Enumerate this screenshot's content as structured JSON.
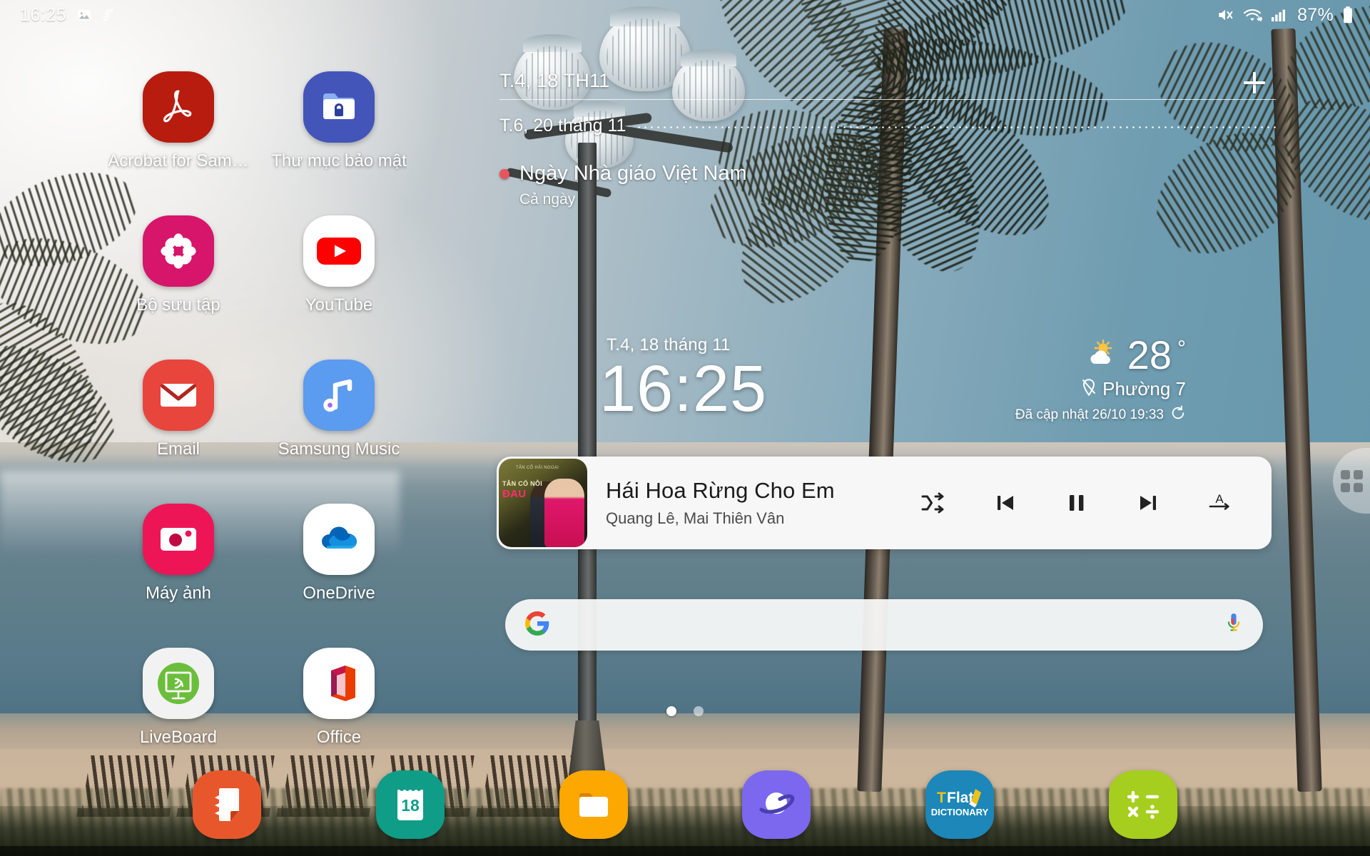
{
  "status_bar": {
    "clock": "16:25",
    "left_icons": [
      "image-icon",
      "music-note-icon"
    ],
    "right_icons": [
      "mute-icon",
      "wifi-icon",
      "signal-icon",
      "battery-icon"
    ],
    "battery_percent": "87%"
  },
  "calendar_widget": {
    "today_label": "T.4, 18 TH11",
    "add_label": "+",
    "next_date": "T.6, 20 tháng 11",
    "event_title": "Ngày Nhà giáo Việt Nam",
    "event_time": "Cả ngày",
    "event_dot_color": "#E8545E"
  },
  "clock_widget": {
    "date": "T.4, 18 tháng 11",
    "time": "16:25"
  },
  "weather_widget": {
    "temperature": "28",
    "degree": "°",
    "condition_icon": "partly-cloudy-icon",
    "location": "Phường 7",
    "updated": "Đã cập nhật 26/10 19:33",
    "refresh_icon": "refresh-icon"
  },
  "apps": [
    {
      "label": "Acrobat for Sam…",
      "icon": "acrobat-icon",
      "color": "#B71C0F"
    },
    {
      "label": "Thư mục bảo mật",
      "icon": "secure-folder-icon",
      "color": "#4355B9"
    },
    {
      "label": "Bộ sưu tập",
      "icon": "gallery-icon",
      "color": "#D6156B"
    },
    {
      "label": "YouTube",
      "icon": "youtube-icon",
      "color": "#FFFFFF"
    },
    {
      "label": "Email",
      "icon": "email-icon",
      "color": "#E8453C"
    },
    {
      "label": "Samsung Music",
      "icon": "samsung-music-icon",
      "color": "#5B9BF0"
    },
    {
      "label": "Máy ảnh",
      "icon": "camera-icon",
      "color": "#EE1556"
    },
    {
      "label": "OneDrive",
      "icon": "onedrive-icon",
      "color": "#FFFFFF"
    },
    {
      "label": "LiveBoard",
      "icon": "liveboard-icon",
      "color": "#F2F2F2"
    },
    {
      "label": "Office",
      "icon": "office-icon",
      "color": "#FFFFFF"
    }
  ],
  "music_widget": {
    "album_art_line0": "TÂN CỔ HẢI NGOẠI",
    "album_art_line1": "TÂN CỔ NỖI",
    "album_art_line2": "ĐAU",
    "title": "Hái Hoa Rừng Cho Em",
    "artist": "Quang Lê, Mai Thiên Vân",
    "controls": [
      {
        "name": "shuffle-icon",
        "label": "Shuffle"
      },
      {
        "name": "previous-icon",
        "label": "Previous"
      },
      {
        "name": "pause-icon",
        "label": "Pause"
      },
      {
        "name": "next-icon",
        "label": "Next"
      },
      {
        "name": "repeat-a-icon",
        "label": "Repeat A"
      }
    ]
  },
  "search_bar": {
    "logo": "google-logo",
    "value": "",
    "placeholder": "",
    "mic_icon": "microphone-icon"
  },
  "page_dots": {
    "count": 2,
    "active_index": 0
  },
  "edge_panel": {
    "handle_icon": "apps-grid-icon"
  },
  "dock": [
    {
      "label": "Samsung Notes",
      "icon": "samsung-notes-icon",
      "color": "#E8572C"
    },
    {
      "label": "Lịch",
      "icon": "calendar-icon",
      "color": "#0F9D87",
      "day": "18"
    },
    {
      "label": "Các tệp của tôi",
      "icon": "my-files-icon",
      "color": "#FCA800"
    },
    {
      "label": "Internet",
      "icon": "samsung-internet-icon",
      "color": "#7B68EE"
    },
    {
      "label": "TFlat Dictionary",
      "icon": "tflat-icon",
      "color": "#1C87B8",
      "text1": "TFlat",
      "text2": "DICTIONARY"
    },
    {
      "label": "Máy tính",
      "icon": "calculator-icon",
      "color": "#A6CE1E"
    }
  ]
}
